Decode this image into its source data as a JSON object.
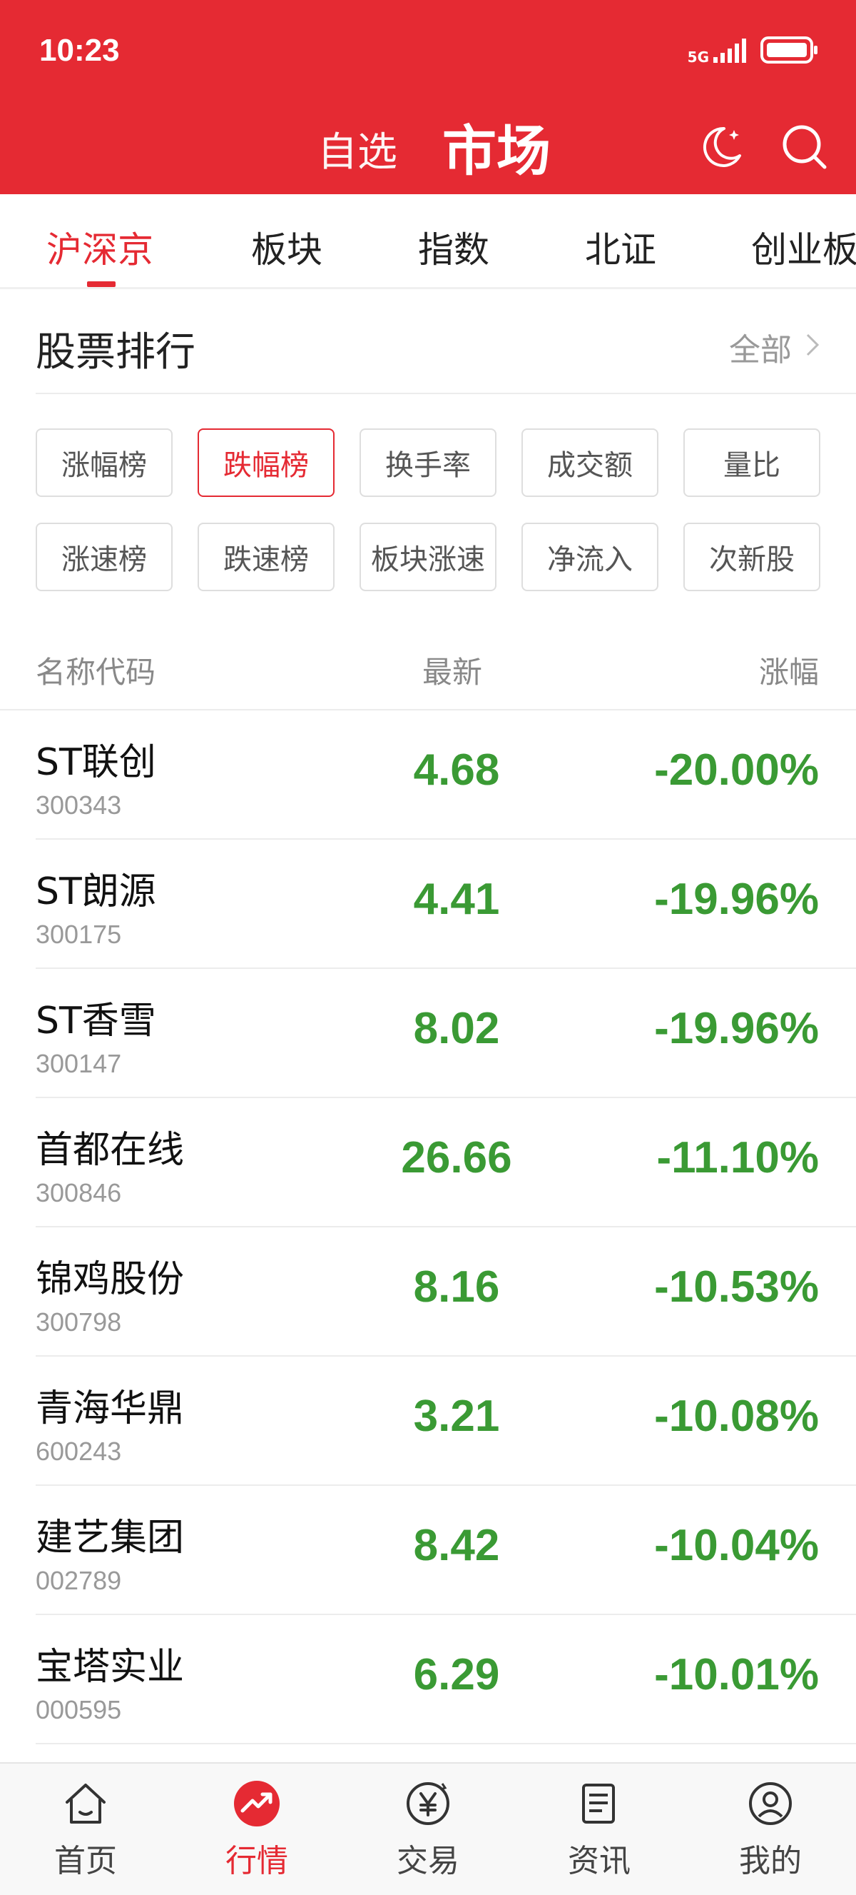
{
  "status": {
    "time": "10:23",
    "network": "5G"
  },
  "header": {
    "tab_watchlist": "自选",
    "tab_market": "市场"
  },
  "category_tabs": [
    "沪深京",
    "板块",
    "指数",
    "北证",
    "创业板"
  ],
  "section": {
    "title": "股票排行",
    "all_label": "全部"
  },
  "filters": [
    [
      "涨幅榜",
      "跌幅榜",
      "换手率",
      "成交额",
      "量比"
    ],
    [
      "涨速榜",
      "跌速榜",
      "板块涨速",
      "净流入",
      "次新股"
    ]
  ],
  "active_filter": "跌幅榜",
  "table": {
    "headers": {
      "name": "名称代码",
      "price": "最新",
      "change": "涨幅"
    },
    "rows": [
      {
        "name": "ST联创",
        "code": "300343",
        "price": "4.68",
        "change": "-20.00%"
      },
      {
        "name": "ST朗源",
        "code": "300175",
        "price": "4.41",
        "change": "-19.96%"
      },
      {
        "name": "ST香雪",
        "code": "300147",
        "price": "8.02",
        "change": "-19.96%"
      },
      {
        "name": "首都在线",
        "code": "300846",
        "price": "26.66",
        "change": "-11.10%"
      },
      {
        "name": "锦鸡股份",
        "code": "300798",
        "price": "8.16",
        "change": "-10.53%"
      },
      {
        "name": "青海华鼎",
        "code": "600243",
        "price": "3.21",
        "change": "-10.08%"
      },
      {
        "name": "建艺集团",
        "code": "002789",
        "price": "8.42",
        "change": "-10.04%"
      },
      {
        "name": "宝塔实业",
        "code": "000595",
        "price": "6.29",
        "change": "-10.01%"
      }
    ]
  },
  "bottom_nav": [
    {
      "label": "首页",
      "icon": "home-icon"
    },
    {
      "label": "行情",
      "icon": "market-trend-icon"
    },
    {
      "label": "交易",
      "icon": "trade-yen-icon"
    },
    {
      "label": "资讯",
      "icon": "news-icon"
    },
    {
      "label": "我的",
      "icon": "profile-icon"
    }
  ],
  "colors": {
    "brand_red": "#e52a33",
    "down_green": "#3a9a34"
  }
}
